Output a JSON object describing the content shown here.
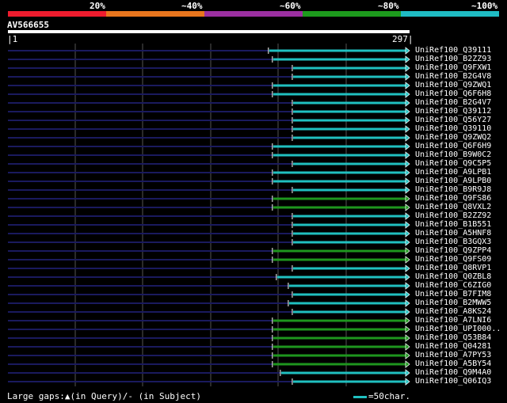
{
  "legend": {
    "segments": [
      {
        "color": "#ee1c2e"
      },
      {
        "color": "#e8761e"
      },
      {
        "color": "#9b2fa0"
      },
      {
        "color": "#1d9a1d"
      },
      {
        "color": "#1fbcc4"
      }
    ],
    "labels": [
      "20%",
      "~40%",
      "~60%",
      "~80%",
      "~100%"
    ]
  },
  "query": {
    "name": "AV566655",
    "start": "1",
    "end": "297"
  },
  "colors": {
    "teal": "#20c0c0",
    "green": "#1e961e",
    "gap_line": "#1a1a5e",
    "grid": "#555555"
  },
  "hits": [
    {
      "name": "UniRef100_Q39111",
      "start": 0.655,
      "color": "teal"
    },
    {
      "name": "UniRef100_B2ZZ93",
      "start": 0.665,
      "color": "teal"
    },
    {
      "name": "UniRef100_Q9FXW1",
      "start": 0.715,
      "color": "teal"
    },
    {
      "name": "UniRef100_B2G4V8",
      "start": 0.715,
      "color": "teal"
    },
    {
      "name": "UniRef100_Q9ZWQ1",
      "start": 0.665,
      "color": "teal"
    },
    {
      "name": "UniRef100_Q6F6H8",
      "start": 0.665,
      "color": "teal"
    },
    {
      "name": "UniRef100_B2G4V7",
      "start": 0.715,
      "color": "teal"
    },
    {
      "name": "UniRef100_Q39112",
      "start": 0.715,
      "color": "teal"
    },
    {
      "name": "UniRef100_Q56Y27",
      "start": 0.715,
      "color": "teal"
    },
    {
      "name": "UniRef100_Q39110",
      "start": 0.715,
      "color": "teal"
    },
    {
      "name": "UniRef100_Q9ZWQ2",
      "start": 0.715,
      "color": "teal"
    },
    {
      "name": "UniRef100_Q6F6H9",
      "start": 0.665,
      "color": "teal"
    },
    {
      "name": "UniRef100_B9W0C2",
      "start": 0.665,
      "color": "teal"
    },
    {
      "name": "UniRef100_Q9C5P5",
      "start": 0.715,
      "color": "teal"
    },
    {
      "name": "UniRef100_A9LPB1",
      "start": 0.665,
      "color": "teal"
    },
    {
      "name": "UniRef100_A9LPB0",
      "start": 0.665,
      "color": "teal"
    },
    {
      "name": "UniRef100_B9R9J8",
      "start": 0.715,
      "color": "teal"
    },
    {
      "name": "UniRef100_Q9FS86",
      "start": 0.665,
      "color": "green"
    },
    {
      "name": "UniRef100_Q8VXL2",
      "start": 0.665,
      "color": "green"
    },
    {
      "name": "UniRef100_B2ZZ92",
      "start": 0.715,
      "color": "teal"
    },
    {
      "name": "UniRef100_B1B551",
      "start": 0.715,
      "color": "teal"
    },
    {
      "name": "UniRef100_A5HNF8",
      "start": 0.715,
      "color": "teal"
    },
    {
      "name": "UniRef100_B3GQX3",
      "start": 0.715,
      "color": "teal"
    },
    {
      "name": "UniRef100_Q9ZPP4",
      "start": 0.665,
      "color": "green"
    },
    {
      "name": "UniRef100_Q9FS09",
      "start": 0.665,
      "color": "green"
    },
    {
      "name": "UniRef100_Q8RVP1",
      "start": 0.715,
      "color": "teal"
    },
    {
      "name": "UniRef100_Q0ZBL8",
      "start": 0.675,
      "color": "teal"
    },
    {
      "name": "UniRef100_C6ZIG0",
      "start": 0.705,
      "color": "teal"
    },
    {
      "name": "UniRef100_B7FIM8",
      "start": 0.715,
      "color": "teal"
    },
    {
      "name": "UniRef100_B2MWW5",
      "start": 0.705,
      "color": "teal"
    },
    {
      "name": "UniRef100_A8KS24",
      "start": 0.715,
      "color": "teal"
    },
    {
      "name": "UniRef100_A7LNI6",
      "start": 0.665,
      "color": "green"
    },
    {
      "name": "UniRef100_UPI000..",
      "start": 0.665,
      "color": "green"
    },
    {
      "name": "UniRef100_Q53B84",
      "start": 0.665,
      "color": "green"
    },
    {
      "name": "UniRef100_Q04281",
      "start": 0.665,
      "color": "green"
    },
    {
      "name": "UniRef100_A7PY53",
      "start": 0.665,
      "color": "green"
    },
    {
      "name": "UniRef100_A5BY54",
      "start": 0.665,
      "color": "green"
    },
    {
      "name": "UniRef100_Q9M4A0",
      "start": 0.685,
      "color": "teal"
    },
    {
      "name": "UniRef100_Q06IQ3",
      "start": 0.715,
      "color": "teal"
    }
  ],
  "footer": {
    "text": "Large gaps:▲(in Query)/- (in Subject)",
    "scale": "=50char."
  }
}
